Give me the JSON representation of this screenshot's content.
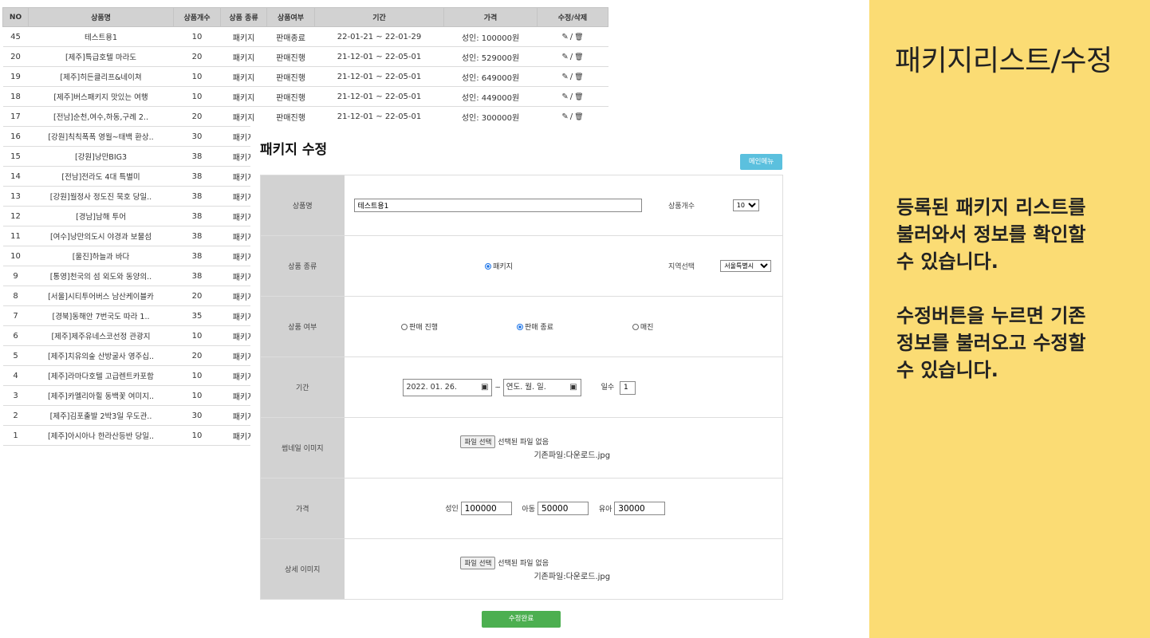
{
  "table": {
    "headers": [
      "NO",
      "상품명",
      "상품개수",
      "상품 종류",
      "상품여부",
      "기간",
      "가격",
      "수정/삭제"
    ],
    "rows": [
      {
        "no": "45",
        "name": "테스트용1",
        "count": "10",
        "type": "패키지",
        "status": "판매종료",
        "period": "22-01-21 ~ 22-01-29",
        "price": "성인: 100000원"
      },
      {
        "no": "20",
        "name": "[제주]특급호텔 마라도",
        "count": "20",
        "type": "패키지",
        "status": "판매진행",
        "period": "21-12-01 ~ 22-05-01",
        "price": "성인: 529000원"
      },
      {
        "no": "19",
        "name": "[제주]히든클리프&네이쳐",
        "count": "10",
        "type": "패키지",
        "status": "판매진행",
        "period": "21-12-01 ~ 22-05-01",
        "price": "성인: 649000원"
      },
      {
        "no": "18",
        "name": "[제주]버스패키지 맛있는 여행",
        "count": "10",
        "type": "패키지",
        "status": "판매진행",
        "period": "21-12-01 ~ 22-05-01",
        "price": "성인: 449000원"
      },
      {
        "no": "17",
        "name": "[전남]순천,여수,하동,구례 2..",
        "count": "20",
        "type": "패키지",
        "status": "판매진행",
        "period": "21-12-01 ~ 22-05-01",
        "price": "성인: 300000원"
      },
      {
        "no": "16",
        "name": "[강원]칙칙폭폭 영월~태백 환상..",
        "count": "30",
        "type": "패키지"
      },
      {
        "no": "15",
        "name": "[강원]낭만BIG3",
        "count": "38",
        "type": "패키지"
      },
      {
        "no": "14",
        "name": "[전남]전라도 4대 특별미",
        "count": "38",
        "type": "패키지"
      },
      {
        "no": "13",
        "name": "[강원]월정사 정도진 묵호 당일..",
        "count": "38",
        "type": "패키지"
      },
      {
        "no": "12",
        "name": "[경남]남해 투어",
        "count": "38",
        "type": "패키지"
      },
      {
        "no": "11",
        "name": "[여수]낭만의도시 야경과 보물섬",
        "count": "38",
        "type": "패키지"
      },
      {
        "no": "10",
        "name": "[울진]하늘과 바다",
        "count": "38",
        "type": "패키지"
      },
      {
        "no": "9",
        "name": "[통영]천국의 섬 외도와 동양의..",
        "count": "38",
        "type": "패키지"
      },
      {
        "no": "8",
        "name": "[서울]시티투어버스 남산케이블카",
        "count": "20",
        "type": "패키지"
      },
      {
        "no": "7",
        "name": "[경북]동해안 7번국도 따라 1..",
        "count": "35",
        "type": "패키지"
      },
      {
        "no": "6",
        "name": "[제주]제주유네스코선정 관광지",
        "count": "10",
        "type": "패키지"
      },
      {
        "no": "5",
        "name": "[제주]치유의숲 산방굴사 영주십..",
        "count": "20",
        "type": "패키지"
      },
      {
        "no": "4",
        "name": "[제주]라마다호텔 고급렌트카포함",
        "count": "10",
        "type": "패키지"
      },
      {
        "no": "3",
        "name": "[제주]카멜리아힐 동백꽃 여미지..",
        "count": "10",
        "type": "패키지"
      },
      {
        "no": "2",
        "name": "[제주]김포출발 2박3일 우도관..",
        "count": "30",
        "type": "패키지"
      },
      {
        "no": "1",
        "name": "[제주]아시아나 한라산등반 당일..",
        "count": "10",
        "type": "패키지"
      }
    ],
    "action_edit": "수정",
    "action_delete": "삭제",
    "action_sep": "/"
  },
  "edit": {
    "title": "패키지 수정",
    "main_menu_label": "메인메뉴",
    "product_name_label": "상품명",
    "product_name_value": "테스트용1",
    "count_label": "상품개수",
    "count_value": "10",
    "type_label": "상품 종류",
    "type_option": "패키지",
    "region_label": "지역선택",
    "region_value": "서울특별시",
    "status_label": "상품 여부",
    "status_options": [
      "판매 진행",
      "판매 종료",
      "매진"
    ],
    "status_selected": 1,
    "period_label": "기간",
    "start_date": "2022. 01. 26.",
    "end_date_placeholder": "연도. 월. 일.",
    "period_sep": "~",
    "days_label": "일수",
    "days_value": "1",
    "thumb_label": "썸네일 이미지",
    "file_button": "파일 선택",
    "no_file": "선택된 파일 없음",
    "existing_file": "기존파일:다운로드.jpg",
    "price_label": "가격",
    "adult_label": "성인",
    "adult_value": "100000",
    "child_label": "아동",
    "child_value": "50000",
    "infant_label": "유아",
    "infant_value": "30000",
    "detail_label": "상세 이미지",
    "submit_label": "수정완료"
  },
  "side": {
    "title": "패키지리스트/수정",
    "para1": "등록된 패키지 리스트를\n불러와서 정보를 확인할\n수 있습니다.",
    "para2": "수정버튼을 누르면 기존\n정보를 불러오고 수정할\n수 있습니다."
  },
  "colors": {
    "side_bg": "#fbdc74",
    "main_menu_btn": "#5bc0de",
    "submit_btn": "#4caf50",
    "header_bg": "#d2d2d2"
  }
}
